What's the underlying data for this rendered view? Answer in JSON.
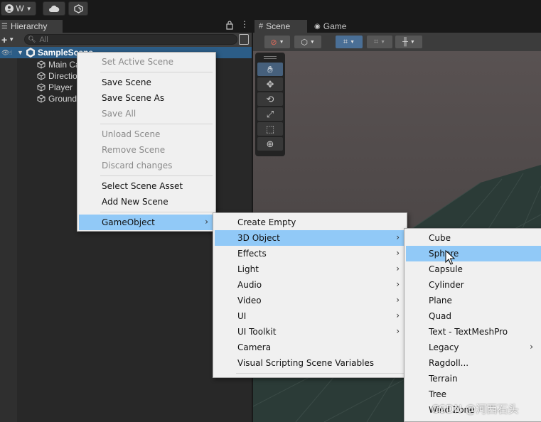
{
  "toolbar": {
    "account_label": "W"
  },
  "hierarchy": {
    "tab_label": "Hierarchy",
    "search_placeholder": "All",
    "scene_name": "SampleScene",
    "children": [
      "Main Camera",
      "Directional Light",
      "Player",
      "Ground"
    ]
  },
  "scene_view": {
    "tabs": [
      "Scene",
      "Game"
    ]
  },
  "context_menu": {
    "items": [
      {
        "label": "Set Active Scene",
        "disabled": true
      },
      {
        "label": "Save Scene",
        "disabled": false
      },
      {
        "label": "Save Scene As",
        "disabled": false
      },
      {
        "label": "Save All",
        "disabled": true
      },
      {
        "label": "Unload Scene",
        "disabled": true
      },
      {
        "label": "Remove Scene",
        "disabled": true
      },
      {
        "label": "Discard changes",
        "disabled": true
      },
      {
        "label": "Select Scene Asset",
        "disabled": false
      },
      {
        "label": "Add New Scene",
        "disabled": false
      },
      {
        "label": "GameObject",
        "disabled": false,
        "submenu": true,
        "highlighted": true
      }
    ]
  },
  "gameobject_menu": {
    "items": [
      {
        "label": "Create Empty"
      },
      {
        "label": "3D Object",
        "submenu": true,
        "highlighted": true
      },
      {
        "label": "Effects",
        "submenu": true
      },
      {
        "label": "Light",
        "submenu": true
      },
      {
        "label": "Audio",
        "submenu": true
      },
      {
        "label": "Video",
        "submenu": true
      },
      {
        "label": "UI",
        "submenu": true
      },
      {
        "label": "UI Toolkit",
        "submenu": true
      },
      {
        "label": "Camera"
      },
      {
        "label": "Visual Scripting Scene Variables"
      }
    ]
  },
  "object3d_menu": {
    "items": [
      {
        "label": "Cube"
      },
      {
        "label": "Sphere",
        "highlighted": true
      },
      {
        "label": "Capsule"
      },
      {
        "label": "Cylinder"
      },
      {
        "label": "Plane"
      },
      {
        "label": "Quad"
      },
      {
        "label": "Text - TextMeshPro"
      },
      {
        "label": "Legacy",
        "submenu": true
      },
      {
        "label": "Ragdoll..."
      },
      {
        "label": "Terrain"
      },
      {
        "label": "Tree"
      },
      {
        "label": "Wind Zone"
      }
    ]
  },
  "watermark": "CSDN @河西石头",
  "colors": {
    "selection": "#2c5d87",
    "menu_highlight": "#91c9f7",
    "menu_bg": "#f0f0f0"
  }
}
